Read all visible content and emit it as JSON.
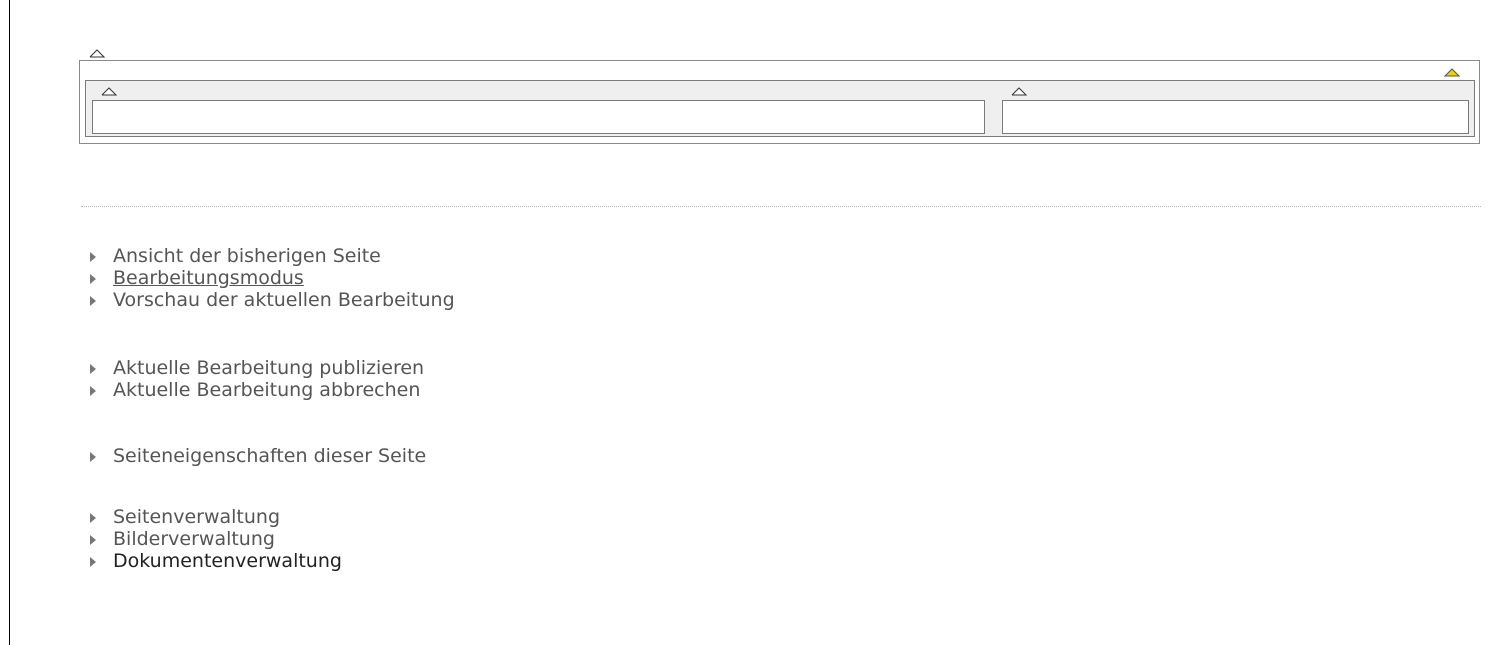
{
  "icons": {
    "outer_caret": "caret-up-icon",
    "warning": "warning-triangle-icon",
    "left_caret": "caret-up-icon",
    "right_caret": "caret-up-icon",
    "bullet": "triangle-right-icon"
  },
  "colors": {
    "warning": "#f0d000",
    "text": "#555555",
    "text_dark": "#222222",
    "border": "#7a7a7a"
  },
  "menu": {
    "view": [
      {
        "label": "Ansicht der bisherigen Seite"
      },
      {
        "label": "Bearbeitungsmodus"
      },
      {
        "label": "Vorschau der aktuellen Bearbeitung"
      }
    ],
    "edit": [
      {
        "label": "Aktuelle Bearbeitung publizieren"
      },
      {
        "label": "Aktuelle Bearbeitung abbrechen"
      }
    ],
    "props": [
      {
        "label": "Seiteneigenschaften dieser Seite"
      }
    ],
    "admin": [
      {
        "label": "Seitenverwaltung"
      },
      {
        "label": "Bilderverwaltung"
      },
      {
        "label": "Dokumentenverwaltung"
      }
    ]
  }
}
